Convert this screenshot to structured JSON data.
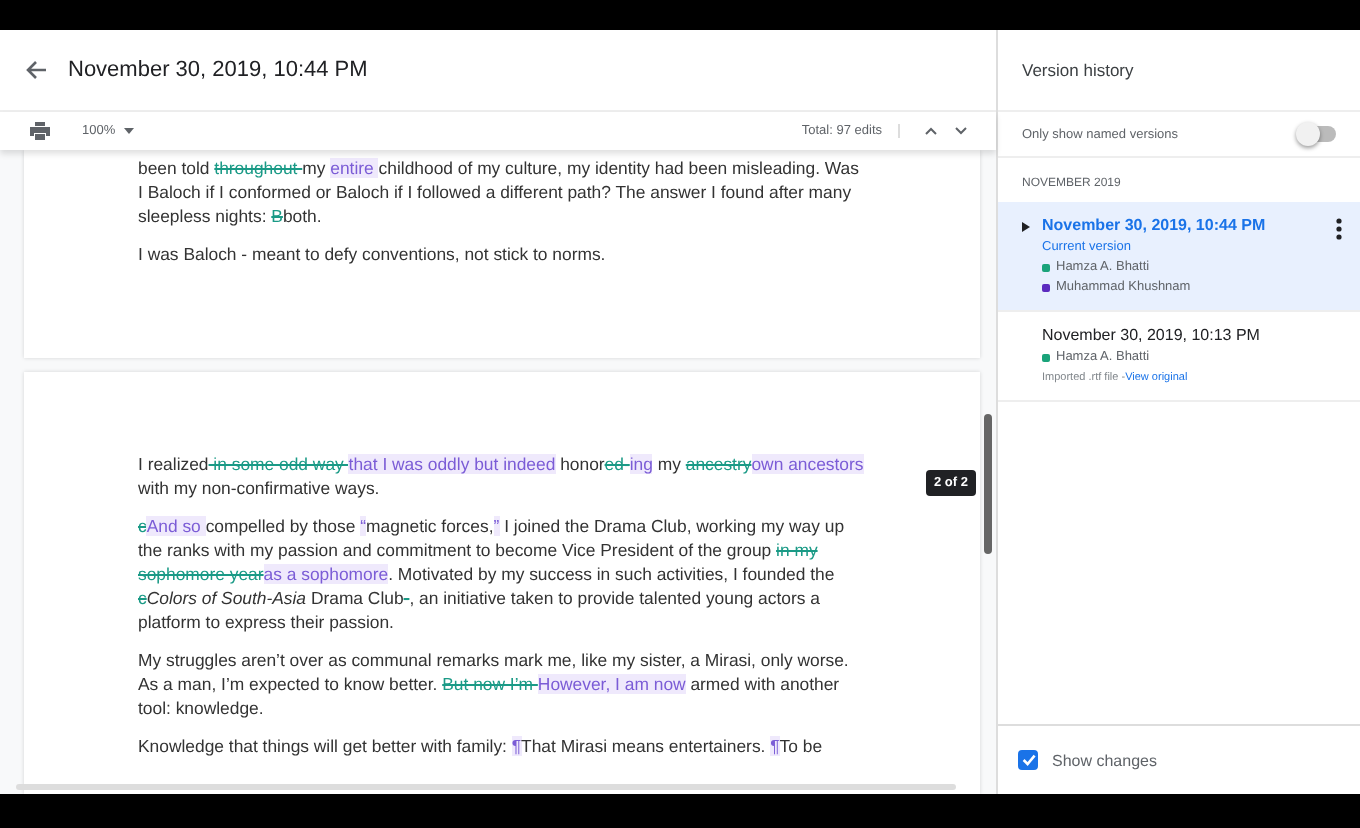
{
  "header": {
    "title": "November 30, 2019, 10:44 PM"
  },
  "toolbar": {
    "zoom": "100%",
    "total": "Total: 97 edits"
  },
  "document": {
    "pages": [
      {
        "paragraphs": [
          [
            {
              "kind": "plain",
              "text": "been told "
            },
            {
              "kind": "del",
              "text": "throughout "
            },
            {
              "kind": "plain",
              "text": "my "
            },
            {
              "kind": "ins",
              "text": "entire "
            },
            {
              "kind": "plain",
              "text": "childhood of my culture, my identity had been misleading. Was I Baloch if I conformed or Baloch if I followed a different path? The answer I found after many sleepless nights: "
            },
            {
              "kind": "del",
              "text": "B"
            },
            {
              "kind": "plain",
              "text": "both."
            }
          ],
          [
            {
              "kind": "plain",
              "text": "I was Baloch - meant to defy conventions, not stick to norms."
            }
          ]
        ]
      },
      {
        "paragraphs": [
          [
            {
              "kind": "plain",
              "text": "I realized"
            },
            {
              "kind": "del",
              "text": " in some odd way "
            },
            {
              "kind": "ins",
              "text": "that I was oddly but indeed"
            },
            {
              "kind": "plain",
              "text": " honor"
            },
            {
              "kind": "del",
              "text": "ed-"
            },
            {
              "kind": "ins",
              "text": "ing"
            },
            {
              "kind": "plain",
              "text": " my "
            },
            {
              "kind": "del",
              "text": "ancestry"
            },
            {
              "kind": "ins",
              "text": "own ancestors"
            },
            {
              "kind": "plain",
              "text": " with my non-confirmative ways."
            }
          ],
          [
            {
              "kind": "del",
              "text": "c"
            },
            {
              "kind": "ins",
              "text": "And so "
            },
            {
              "kind": "plain",
              "text": "compelled by those "
            },
            {
              "kind": "ins",
              "text": "“"
            },
            {
              "kind": "plain",
              "text": "magnetic forces,"
            },
            {
              "kind": "ins",
              "text": "”"
            },
            {
              "kind": "plain",
              "text": " I joined the Drama Club, working my way up the ranks with my passion and commitment to become Vice President of the group "
            },
            {
              "kind": "del",
              "text": "in my sophomore year"
            },
            {
              "kind": "ins",
              "text": "as a sophomore"
            },
            {
              "kind": "plain",
              "text": ".  Motivated by my success in such activities, I founded the "
            },
            {
              "kind": "del",
              "text": "c"
            },
            {
              "kind": "italic",
              "text": "Colors of South-Asia"
            },
            {
              "kind": "plain",
              "text": " Drama Club"
            },
            {
              "kind": "del",
              "text": "-"
            },
            {
              "kind": "plain",
              "text": ", an initiative taken to provide talented young actors a platform to express their passion."
            }
          ],
          [
            {
              "kind": "plain",
              "text": "My struggles aren’t over as communal remarks mark me, like my sister, a Mirasi, only worse. As a man, I’m expected to know better. "
            },
            {
              "kind": "del",
              "text": "But now I’m "
            },
            {
              "kind": "ins",
              "text": "However, I am now"
            },
            {
              "kind": "plain",
              "text": " armed with another tool: knowledge."
            }
          ],
          [
            {
              "kind": "plain",
              "text": "Knowledge that things will get better with family: "
            },
            {
              "kind": "ins",
              "text": "¶"
            },
            {
              "kind": "plain",
              "text": "That Mirasi means entertainers. "
            },
            {
              "kind": "ins",
              "text": "¶"
            },
            {
              "kind": "plain",
              "text": "To be"
            }
          ]
        ]
      }
    ]
  },
  "scroll_tooltip": "2 of 2",
  "panel": {
    "title": "Version history",
    "named_only": {
      "label": "Only show named versions",
      "on": false
    },
    "month": "NOVEMBER 2019",
    "versions": [
      {
        "date": "November 30, 2019, 10:44 PM",
        "selected": true,
        "caption": "Current version",
        "authors": [
          {
            "name": "Hamza A. Bhatti",
            "color": "#1aa37a"
          },
          {
            "name": "Muhammad Khushnam",
            "color": "#5b2bbf"
          }
        ]
      },
      {
        "date": "November 30, 2019, 10:13 PM",
        "selected": false,
        "authors": [
          {
            "name": "Hamza A. Bhatti",
            "color": "#1aa37a"
          }
        ],
        "note": "Imported .rtf file - ",
        "link": "View original"
      }
    ],
    "show_changes": {
      "label": "Show changes",
      "checked": true
    }
  }
}
